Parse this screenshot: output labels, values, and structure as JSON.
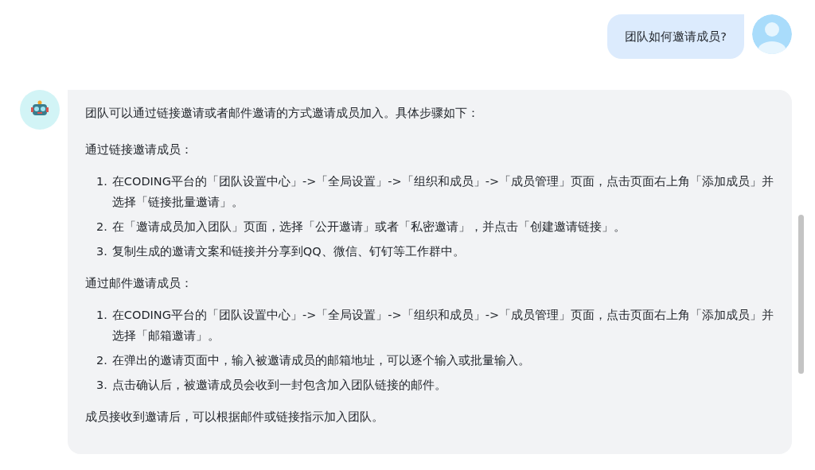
{
  "messages": [
    {
      "kind": "user",
      "text": "团队如何邀请成员?"
    },
    {
      "kind": "bot",
      "blocks": [
        {
          "kind": "paragraph",
          "text": "团队可以通过链接邀请或者邮件邀请的方式邀请成员加入。具体步骤如下："
        },
        {
          "kind": "paragraph",
          "text": "通过链接邀请成员："
        },
        {
          "kind": "list",
          "items": [
            {
              "number": "1.",
              "text": "在CODING平台的「团队设置中心」->「全局设置」->「组织和成员」->「成员管理」页面，点击页面右上角「添加成员」并选择「链接批量邀请」。"
            },
            {
              "number": "2.",
              "text": "在「邀请成员加入团队」页面，选择「公开邀请」或者「私密邀请」，并点击「创建邀请链接」。"
            },
            {
              "number": "3.",
              "text": "复制生成的邀请文案和链接并分享到QQ、微信、钉钉等工作群中。"
            }
          ]
        },
        {
          "kind": "paragraph",
          "text": "通过邮件邀请成员："
        },
        {
          "kind": "list",
          "items": [
            {
              "number": "1.",
              "text": "在CODING平台的「团队设置中心」->「全局设置」->「组织和成员」->「成员管理」页面，点击页面右上角「添加成员」并选择「邮箱邀请」。"
            },
            {
              "number": "2.",
              "text": "在弹出的邀请页面中，输入被邀请成员的邮箱地址，可以逐个输入或批量输入。"
            },
            {
              "number": "3.",
              "text": "点击确认后，被邀请成员会收到一封包含加入团队链接的邮件。"
            }
          ]
        },
        {
          "kind": "paragraph",
          "text": "成员接收到邀请后，可以根据邮件或链接指示加入团队。"
        }
      ]
    }
  ]
}
